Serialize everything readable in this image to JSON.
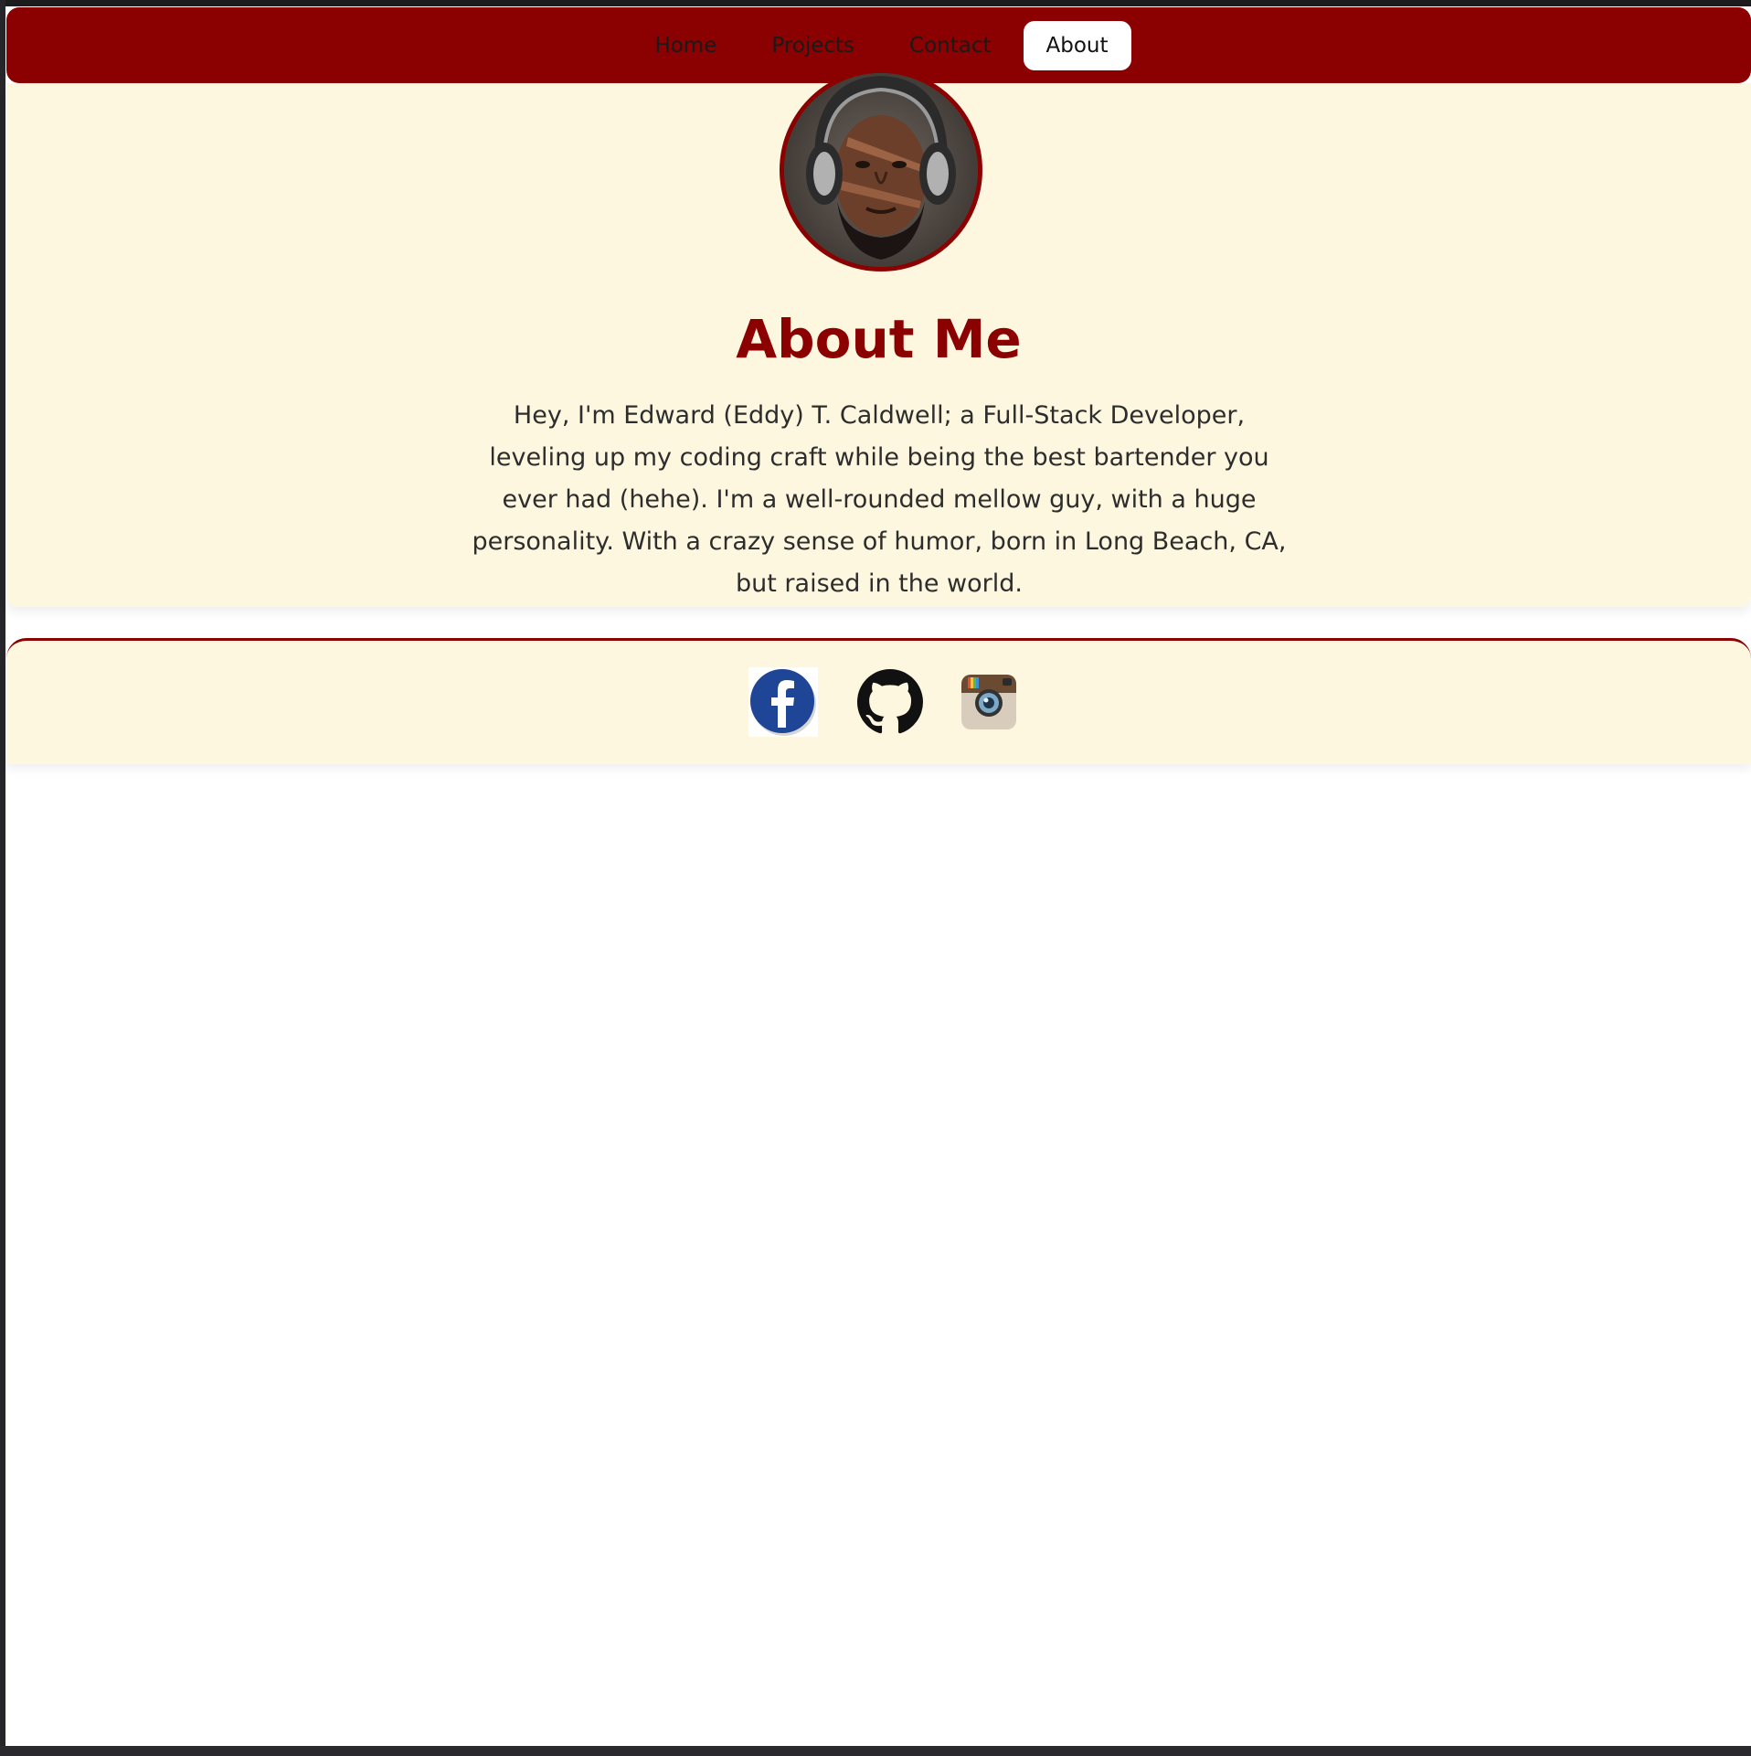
{
  "nav": {
    "items": [
      {
        "label": "Home",
        "active": false
      },
      {
        "label": "Projects",
        "active": false
      },
      {
        "label": "Contact",
        "active": false
      },
      {
        "label": "About",
        "active": true
      }
    ]
  },
  "about": {
    "avatar": "profile-photo",
    "title": "About Me",
    "text": "Hey, I'm Edward (Eddy) T. Caldwell; a Full-Stack Developer, leveling up my coding craft while being the best bartender you ever had (hehe). I'm a well-rounded mellow guy, with a huge personality. With a crazy sense of humor, born in Long Beach, CA, but raised in the world."
  },
  "footer": {
    "social": [
      "facebook-icon",
      "github-icon",
      "instagram-icon"
    ]
  },
  "colors": {
    "accent": "#8b0000",
    "card_background": "#fef7df",
    "page_background": "#ffffff",
    "text": "#2d2d2d"
  }
}
